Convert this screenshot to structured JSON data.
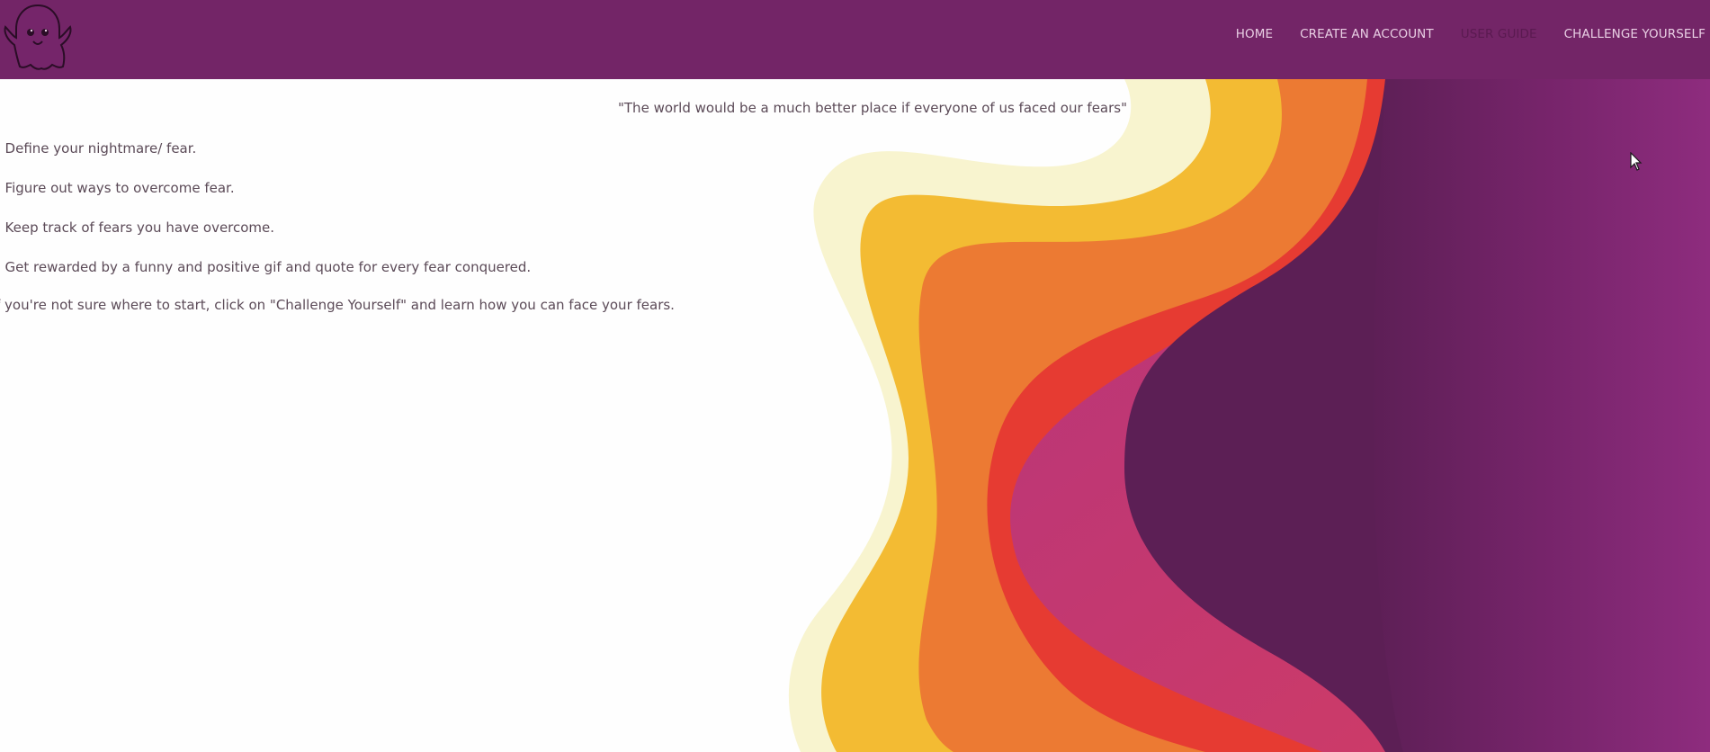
{
  "navbar": {
    "logo_icon": "ghost-icon",
    "links": [
      {
        "label": "HOME"
      },
      {
        "label": "CREATE AN ACCOUNT"
      },
      {
        "label": "USER GUIDE"
      },
      {
        "label": "CHALLENGE YOURSELF"
      }
    ],
    "active_link": "USER GUIDE"
  },
  "main": {
    "quote": "\"The world would be a much better place if everyone of us faced our fears\"",
    "steps": [
      ". Define your nightmare/ fear.",
      ". Figure out ways to overcome fear.",
      ". Keep track of fears you have overcome.",
      ". Get rewarded by a funny and positive gif and quote for every fear conquered."
    ],
    "cta": "f you're not sure where to start, click on \"Challenge Yourself\" and learn how you can face your fears."
  },
  "colors": {
    "navbar": "#732567",
    "cream": "#f8f4cf",
    "yellow": "#f3bb33",
    "orange": "#ec7a33",
    "red": "#e63b32",
    "pink": "#cc3b69",
    "dark_purple": "#5c1f55",
    "purple": "#8a2a7b"
  }
}
